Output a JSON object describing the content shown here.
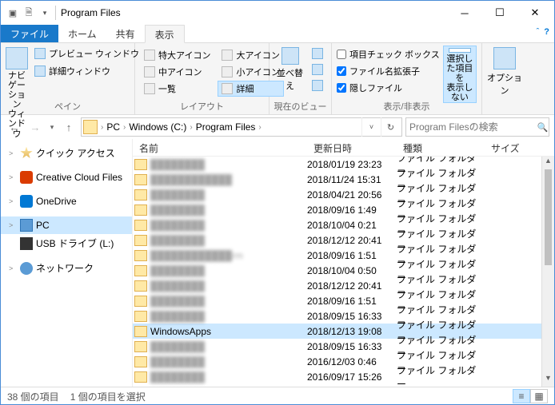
{
  "title": "Program Files",
  "tabs": {
    "file": "ファイル",
    "home": "ホーム",
    "share": "共有",
    "view": "表示"
  },
  "ribbon": {
    "pane": {
      "nav": "ナビゲーション\nウィンドウ",
      "preview": "プレビュー ウィンドウ",
      "details": "詳細ウィンドウ",
      "label": "ペイン"
    },
    "layout": {
      "xl": "特大アイコン",
      "lg": "大アイコン",
      "md": "中アイコン",
      "sm": "小アイコン",
      "list": "一覧",
      "detail": "詳細",
      "label": "レイアウト"
    },
    "view": {
      "sort": "並べ替え",
      "label": "現在のビュー"
    },
    "show": {
      "checkboxes": "項目チェック ボックス",
      "ext": "ファイル名拡張子",
      "hidden": "隠しファイル",
      "hidesel": "選択した項目を\n表示しない",
      "label": "表示/非表示"
    },
    "options": "オプション"
  },
  "breadcrumb": [
    "PC",
    "Windows (C:)",
    "Program Files"
  ],
  "search_placeholder": "Program Filesの検索",
  "tree": [
    {
      "icon": "i-star",
      "label": "クイック アクセス",
      "exp": ">"
    },
    {
      "icon": "i-cc",
      "label": "Creative Cloud Files",
      "exp": ">"
    },
    {
      "icon": "i-od",
      "label": "OneDrive",
      "exp": ">"
    },
    {
      "icon": "i-pc",
      "label": "PC",
      "exp": ">",
      "sel": true
    },
    {
      "icon": "i-usb",
      "label": "USB ドライブ (L:)",
      "exp": ""
    },
    {
      "icon": "i-net",
      "label": "ネットワーク",
      "exp": ">"
    }
  ],
  "columns": {
    "name": "名前",
    "date": "更新日時",
    "type": "種類",
    "size": "サイズ"
  },
  "rows": [
    {
      "name": "████████",
      "date": "2018/01/19 23:23",
      "type": "ファイル フォルダー",
      "blur": true
    },
    {
      "name": "████████████",
      "date": "2018/11/24 15:31",
      "type": "ファイル フォルダー",
      "blur": true
    },
    {
      "name": "████████",
      "date": "2018/04/21 20:56",
      "type": "ファイル フォルダー",
      "blur": true
    },
    {
      "name": "████████",
      "date": "2018/09/16 1:49",
      "type": "ファイル フォルダー",
      "blur": true
    },
    {
      "name": "████████",
      "date": "2018/10/04 0:21",
      "type": "ファイル フォルダー",
      "blur": true
    },
    {
      "name": "████████",
      "date": "2018/12/12 20:41",
      "type": "ファイル フォルダー",
      "blur": true
    },
    {
      "name": "████████████rm",
      "date": "2018/09/16 1:51",
      "type": "ファイル フォルダー",
      "blur": true
    },
    {
      "name": "████████",
      "date": "2018/10/04 0:50",
      "type": "ファイル フォルダー",
      "blur": true
    },
    {
      "name": "████████",
      "date": "2018/12/12 20:41",
      "type": "ファイル フォルダー",
      "blur": true
    },
    {
      "name": "████████",
      "date": "2018/09/16 1:51",
      "type": "ファイル フォルダー",
      "blur": true
    },
    {
      "name": "████████",
      "date": "2018/09/15 16:33",
      "type": "ファイル フォルダー",
      "blur": true
    },
    {
      "name": "WindowsApps",
      "date": "2018/12/13 19:08",
      "type": "ファイル フォルダー",
      "sel": true
    },
    {
      "name": "████████",
      "date": "2018/09/15 16:33",
      "type": "ファイル フォルダー",
      "blur": true
    },
    {
      "name": "████████",
      "date": "2016/12/03 0:46",
      "type": "ファイル フォルダー",
      "blur": true
    },
    {
      "name": "████████",
      "date": "2016/09/17 15:26",
      "type": "ファイル フォルダー",
      "blur": true
    }
  ],
  "status": {
    "count": "38 個の項目",
    "selected": "1 個の項目を選択"
  }
}
